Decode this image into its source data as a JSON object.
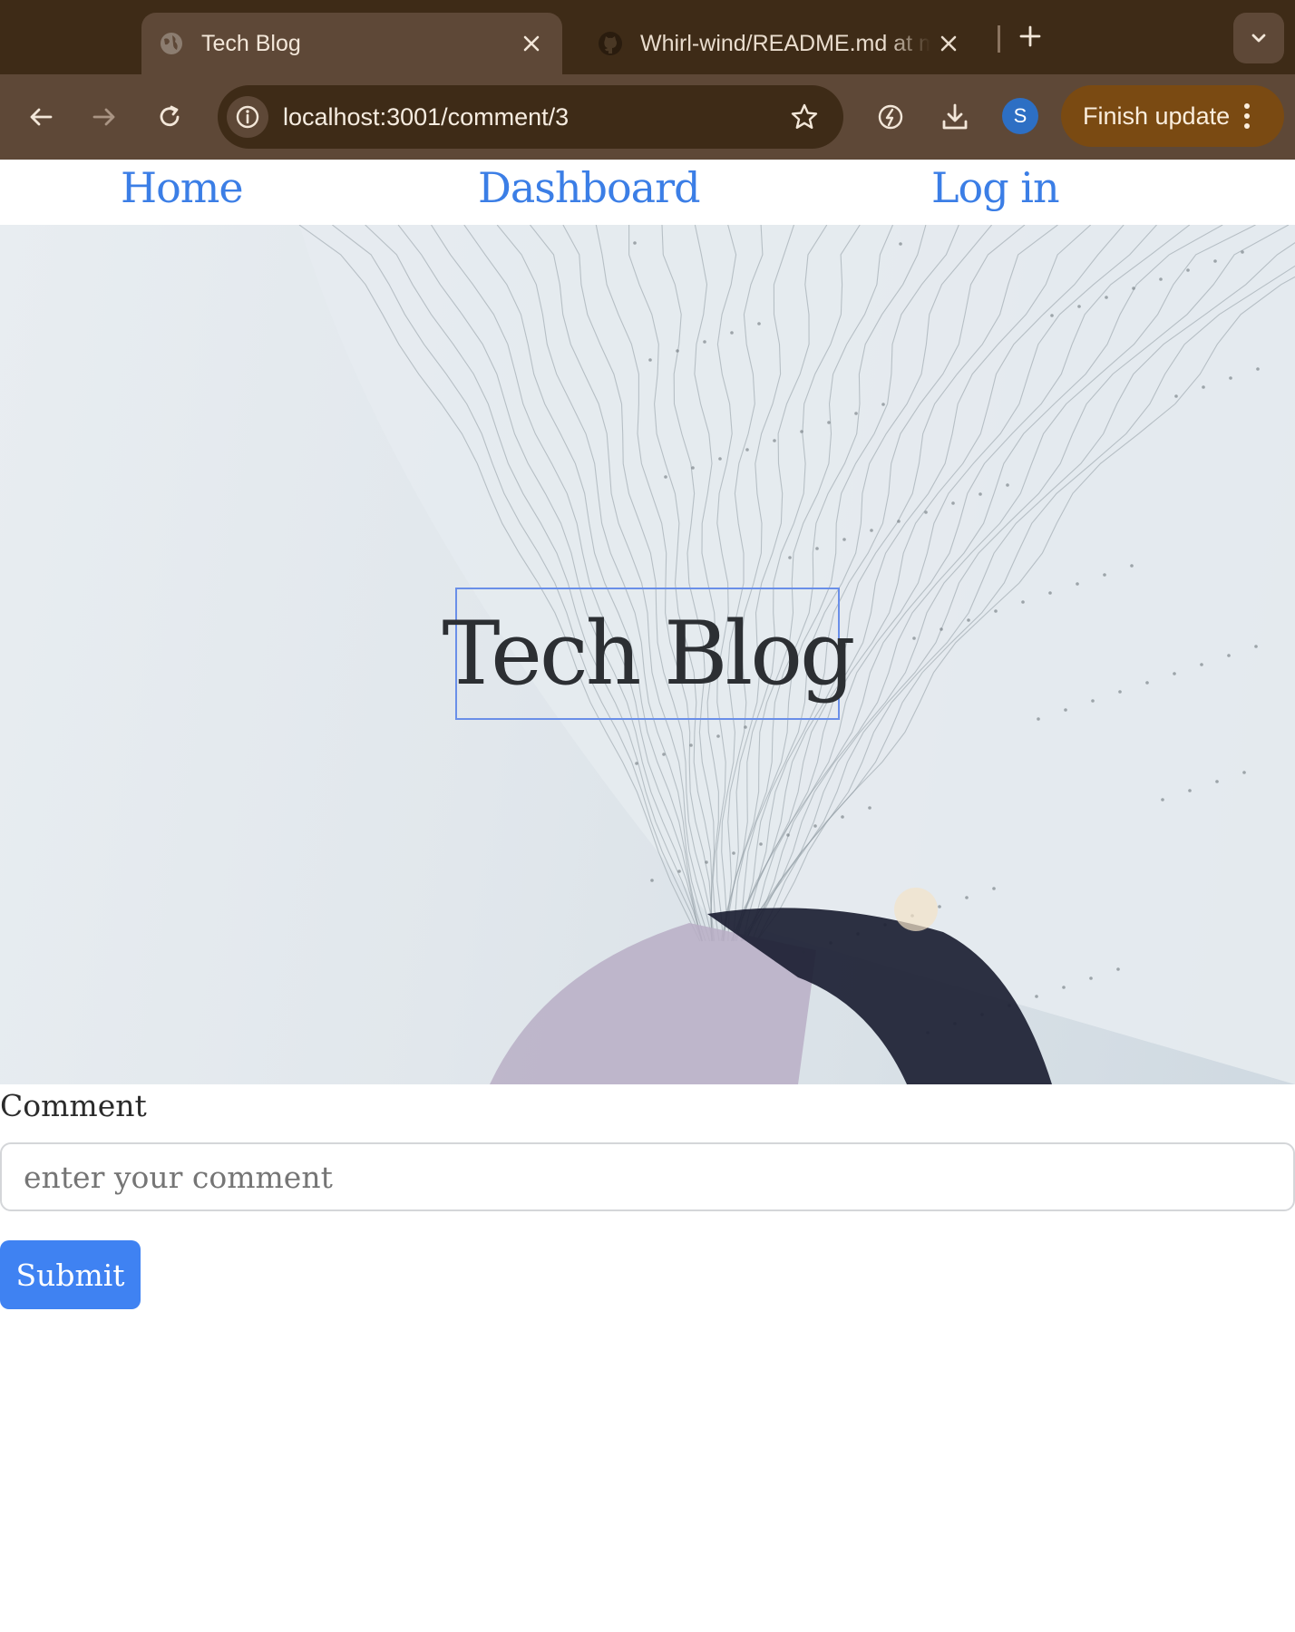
{
  "browser": {
    "tabs": [
      {
        "title": "Tech Blog",
        "active": true,
        "icon": "globe-icon"
      },
      {
        "title": "Whirl-wind/README.md at main",
        "active": false,
        "icon": "github-icon"
      }
    ],
    "url": "localhost:3001/comment/3",
    "profile_initial": "S",
    "update_label": "Finish update",
    "colors": {
      "tabstrip": "#3e2b17",
      "toolbar": "#5e4837",
      "update_button": "#7a4a12",
      "avatar": "#2d6fc4"
    }
  },
  "site_nav": {
    "items": [
      {
        "label": "Home"
      },
      {
        "label": "Dashboard"
      },
      {
        "label": "Log in"
      }
    ],
    "link_color": "#3b7ee6"
  },
  "hero": {
    "title": "Tech Blog"
  },
  "comment_form": {
    "label": "Comment",
    "placeholder": "enter your comment",
    "value": "",
    "submit_label": "Submit",
    "button_color": "#3f82f2"
  }
}
